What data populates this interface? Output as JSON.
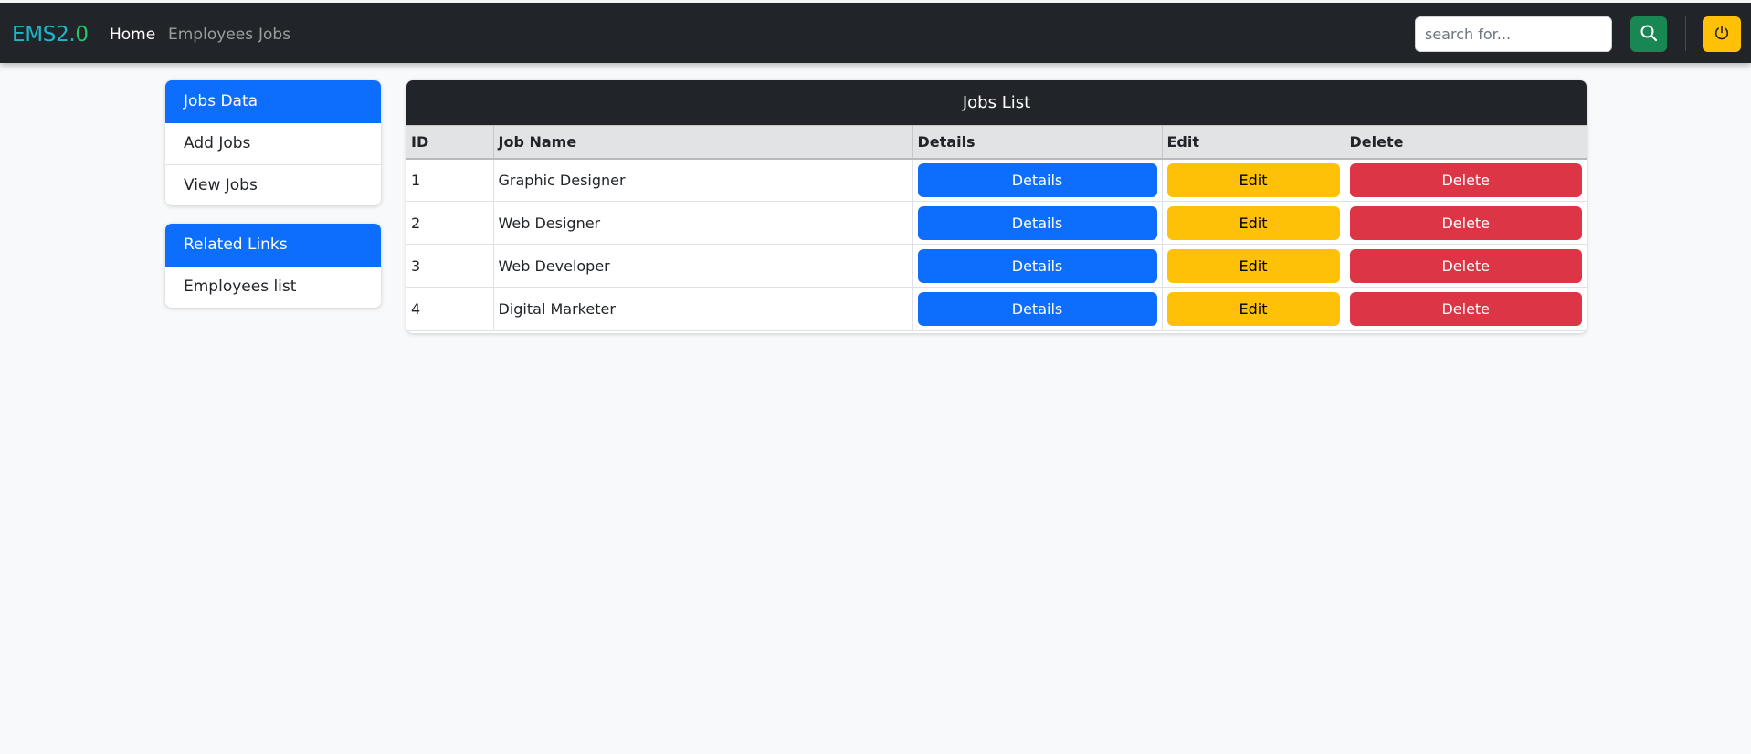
{
  "navbar": {
    "brand_part1": "EMS2.",
    "brand_part2": "0",
    "links": [
      {
        "label": "Home"
      },
      {
        "label": "Employees"
      },
      {
        "label": "Jobs"
      }
    ],
    "search_placeholder": "search for...",
    "search_icon": "search-icon",
    "power_icon": "power-icon"
  },
  "sidebar": {
    "jobs_data": {
      "header": "Jobs Data",
      "items": [
        {
          "label": "Add Jobs"
        },
        {
          "label": "View Jobs"
        }
      ]
    },
    "related": {
      "header": "Related Links",
      "items": [
        {
          "label": "Employees list"
        }
      ]
    }
  },
  "jobs": {
    "title": "Jobs List",
    "columns": [
      "ID",
      "Job Name",
      "Details",
      "Edit",
      "Delete"
    ],
    "rows": [
      {
        "id": "1",
        "name": "Graphic Designer",
        "details": "Details",
        "edit": "Edit",
        "delete": "Delete"
      },
      {
        "id": "2",
        "name": "Web Designer",
        "details": "Details",
        "edit": "Edit",
        "delete": "Delete"
      },
      {
        "id": "3",
        "name": "Web Developer",
        "details": "Details",
        "edit": "Edit",
        "delete": "Delete"
      },
      {
        "id": "4",
        "name": "Digital Marketer",
        "details": "Details",
        "edit": "Edit",
        "delete": "Delete"
      }
    ]
  },
  "colors": {
    "navbar_bg": "#212529",
    "primary": "#0d6efd",
    "success": "#198754",
    "warning": "#ffc107",
    "danger": "#dc3545",
    "brand_cyan": "#1fb6c9",
    "brand_green": "#20c968"
  }
}
